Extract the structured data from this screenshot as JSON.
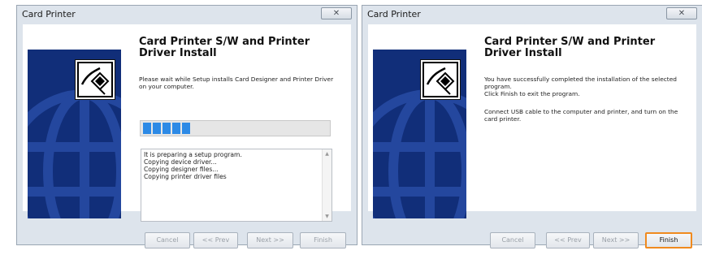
{
  "windows": [
    {
      "title": "Card Printer",
      "close_glyph": "✕",
      "heading": "Card Printer S/W and Printer Driver Install",
      "message": "Please wait while Setup installs Card Designer and Printer Driver on your computer.",
      "progress_blocks": 5,
      "log_lines": [
        "It is preparing a setup program.",
        "Copying device driver...",
        "Copying designer files...",
        "Copying printer driver files"
      ],
      "buttons": {
        "cancel": "Cancel",
        "prev": "<< Prev",
        "next": "Next >>",
        "finish": "Finish"
      }
    },
    {
      "title": "Card Printer",
      "close_glyph": "✕",
      "heading": "Card Printer S/W and Printer Driver Install",
      "message": "You have successfully completed the installation of the selected program.\nClick Finish to exit the program.",
      "message2": "Connect USB cable to the computer and printer, and turn on the card printer.",
      "buttons": {
        "cancel": "Cancel",
        "prev": "<< Prev",
        "next": "Next >>",
        "finish": "Finish"
      }
    }
  ],
  "colors": {
    "banner": "#112e79",
    "progress": "#2d8ae6",
    "focus_border": "#f08a1e"
  },
  "icons": [
    "install-cable-icon",
    "close-icon"
  ]
}
